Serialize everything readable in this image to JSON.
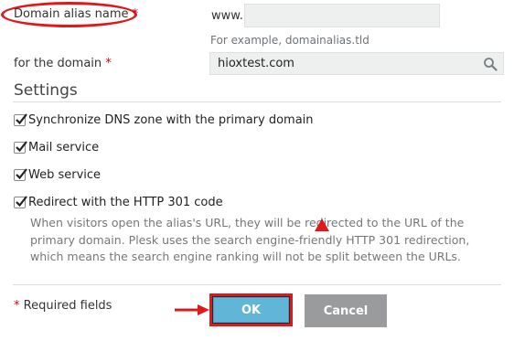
{
  "form": {
    "alias_label": "Domain alias name",
    "alias_prefix": "www.",
    "alias_value": "",
    "alias_hint": "For example, domainalias.tld",
    "domain_label": "for the domain",
    "domain_value": "hioxtest.com",
    "required_mark": "*"
  },
  "settings": {
    "title": "Settings",
    "options": [
      {
        "label": "Synchronize DNS zone with the primary domain",
        "checked": true
      },
      {
        "label": "Mail service",
        "checked": true
      },
      {
        "label": "Web service",
        "checked": true
      },
      {
        "label": "Redirect with the HTTP 301 code",
        "checked": true
      }
    ],
    "redirect_description": "When visitors open the alias's URL, they will be redirected to the URL of the primary domain. Plesk uses the search engine-friendly HTTP 301 redirection, which means the search engine ranking will not be split between the URLs."
  },
  "footer": {
    "required_mark": "*",
    "required_label": "Required fields",
    "ok_label": "OK",
    "cancel_label": "Cancel"
  },
  "icons": {
    "search": "search-icon",
    "checkmark": "checkmark-icon",
    "annotation_arrow": "arrow-right-icon",
    "annotation_pointer": "triangle-up-icon"
  },
  "colors": {
    "annotation": "#e01818",
    "ok_button": "#61b5d6",
    "cancel_button": "#9a9b9d",
    "required": "#d8000c"
  }
}
